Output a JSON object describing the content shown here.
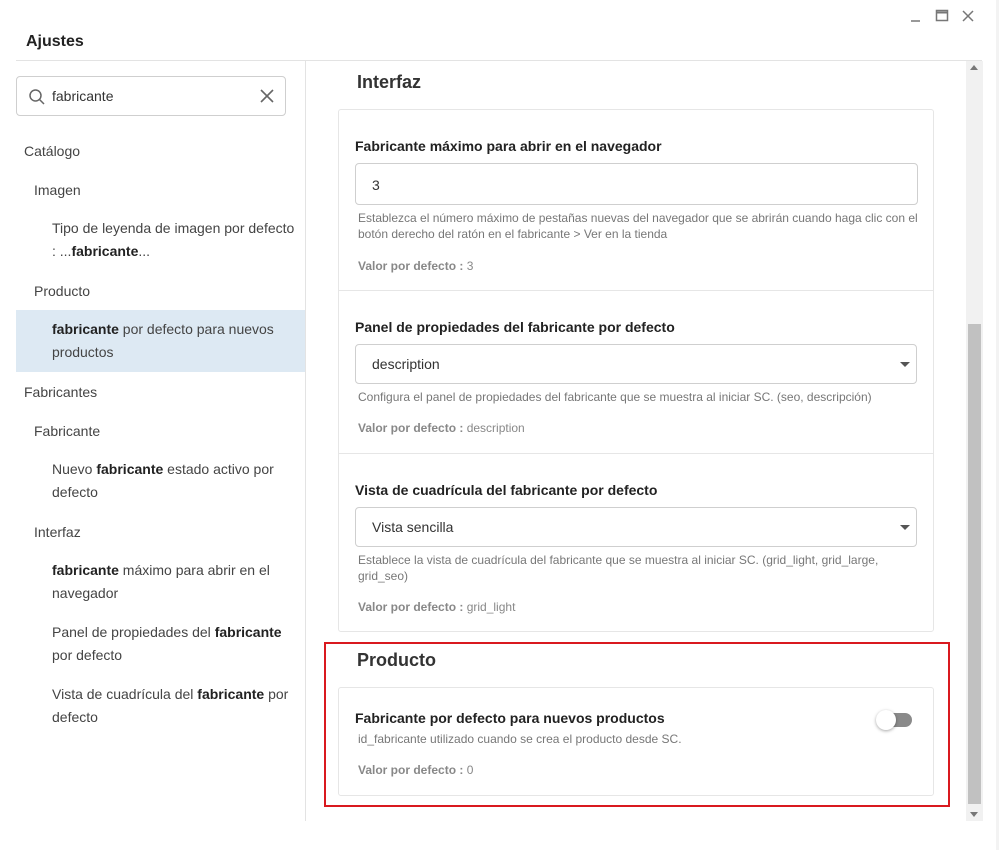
{
  "window": {
    "title": "Ajustes",
    "controls": {
      "minimize": "minimize-icon",
      "maximize": "maximize-icon",
      "close": "close-icon"
    }
  },
  "search": {
    "value": "fabricante",
    "icon": "search-icon",
    "clear_icon": "clear-icon"
  },
  "tree": {
    "catalogo": "Catálogo",
    "imagen": "Imagen",
    "imagen_item": {
      "pre": "Tipo de leyenda de imagen por defecto : ...",
      "bold": "fabricante",
      "post": "..."
    },
    "producto": "Producto",
    "producto_item": {
      "bold": "fabricante",
      "post": " por defecto para nuevos productos"
    },
    "fabricantes": "Fabricantes",
    "fabricante": "Fabricante",
    "fabricante_item": {
      "pre": "Nuevo ",
      "bold": "fabricante",
      "post": " estado activo por defecto"
    },
    "interfaz": "Interfaz",
    "interfaz_item_1": {
      "bold": "fabricante",
      "post": " máximo para abrir en el navegador"
    },
    "interfaz_item_2": {
      "pre": "Panel de propiedades del ",
      "bold": "fabricante",
      "post": " por defecto"
    },
    "interfaz_item_3": {
      "pre": "Vista de cuadrícula del ",
      "bold": "fabricante",
      "post": " por defecto"
    }
  },
  "main": {
    "interfaz_title": "Interfaz",
    "field_max": {
      "label": "Fabricante máximo para abrir en el navegador",
      "value": "3",
      "help": "Establezca el número máximo de pestañas nuevas del navegador que se abrirán cuando haga clic con el botón derecho del ratón en el fabricante > Ver en la tienda",
      "default_label": "Valor por defecto :",
      "default_value": "3"
    },
    "field_panel": {
      "label": "Panel de propiedades del fabricante por defecto",
      "value": "description",
      "help": "Configura el panel de propiedades del fabricante que se muestra al iniciar SC. (seo, descripción)",
      "default_label": "Valor por defecto :",
      "default_value": "description"
    },
    "field_grid": {
      "label": "Vista de cuadrícula del fabricante por defecto",
      "value": "Vista sencilla",
      "help": "Establece la vista de cuadrícula del fabricante que se muestra al iniciar SC. (grid_light, grid_large, grid_seo)",
      "default_label": "Valor por defecto :",
      "default_value": "grid_light"
    },
    "producto_title": "Producto",
    "field_default": {
      "label": "Fabricante por defecto para nuevos productos",
      "help": "id_fabricante utilizado cuando se crea el producto desde SC.",
      "default_label": "Valor por defecto :",
      "default_value": "0",
      "toggle_on": false
    }
  },
  "colors": {
    "highlight": "#d9191f",
    "selected_bg": "#dde9f3",
    "toggle_off": "#8a8a8a"
  }
}
